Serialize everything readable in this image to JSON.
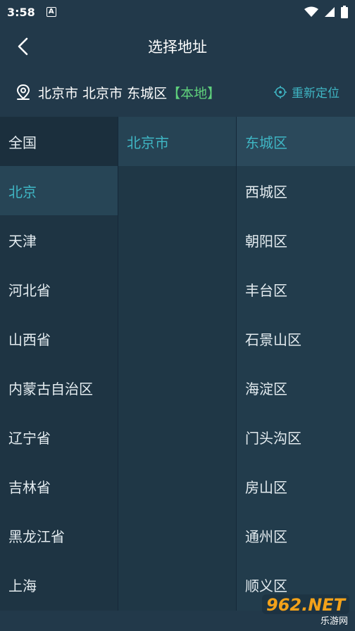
{
  "status_bar": {
    "time": "3:58",
    "notification_letter": "A"
  },
  "header": {
    "title": "选择地址"
  },
  "location": {
    "address": "北京市 北京市 东城区",
    "tag": "【本地】",
    "relocate_label": "重新定位"
  },
  "provinces": [
    {
      "label": "全国"
    },
    {
      "label": "北京"
    },
    {
      "label": "天津"
    },
    {
      "label": "河北省"
    },
    {
      "label": "山西省"
    },
    {
      "label": "内蒙古自治区"
    },
    {
      "label": "辽宁省"
    },
    {
      "label": "吉林省"
    },
    {
      "label": "黑龙江省"
    },
    {
      "label": "上海"
    }
  ],
  "cities": [
    {
      "label": "北京市"
    }
  ],
  "districts": [
    {
      "label": "东城区"
    },
    {
      "label": "西城区"
    },
    {
      "label": "朝阳区"
    },
    {
      "label": "丰台区"
    },
    {
      "label": "石景山区"
    },
    {
      "label": "海淀区"
    },
    {
      "label": "门头沟区"
    },
    {
      "label": "房山区"
    },
    {
      "label": "通州区"
    },
    {
      "label": "顺义区"
    }
  ],
  "watermark": {
    "brand": "962.NET",
    "subtitle": "乐游网"
  },
  "colors": {
    "accent": "#3fb6c4",
    "local_tag": "#5fd07c",
    "background": "#22394a"
  }
}
